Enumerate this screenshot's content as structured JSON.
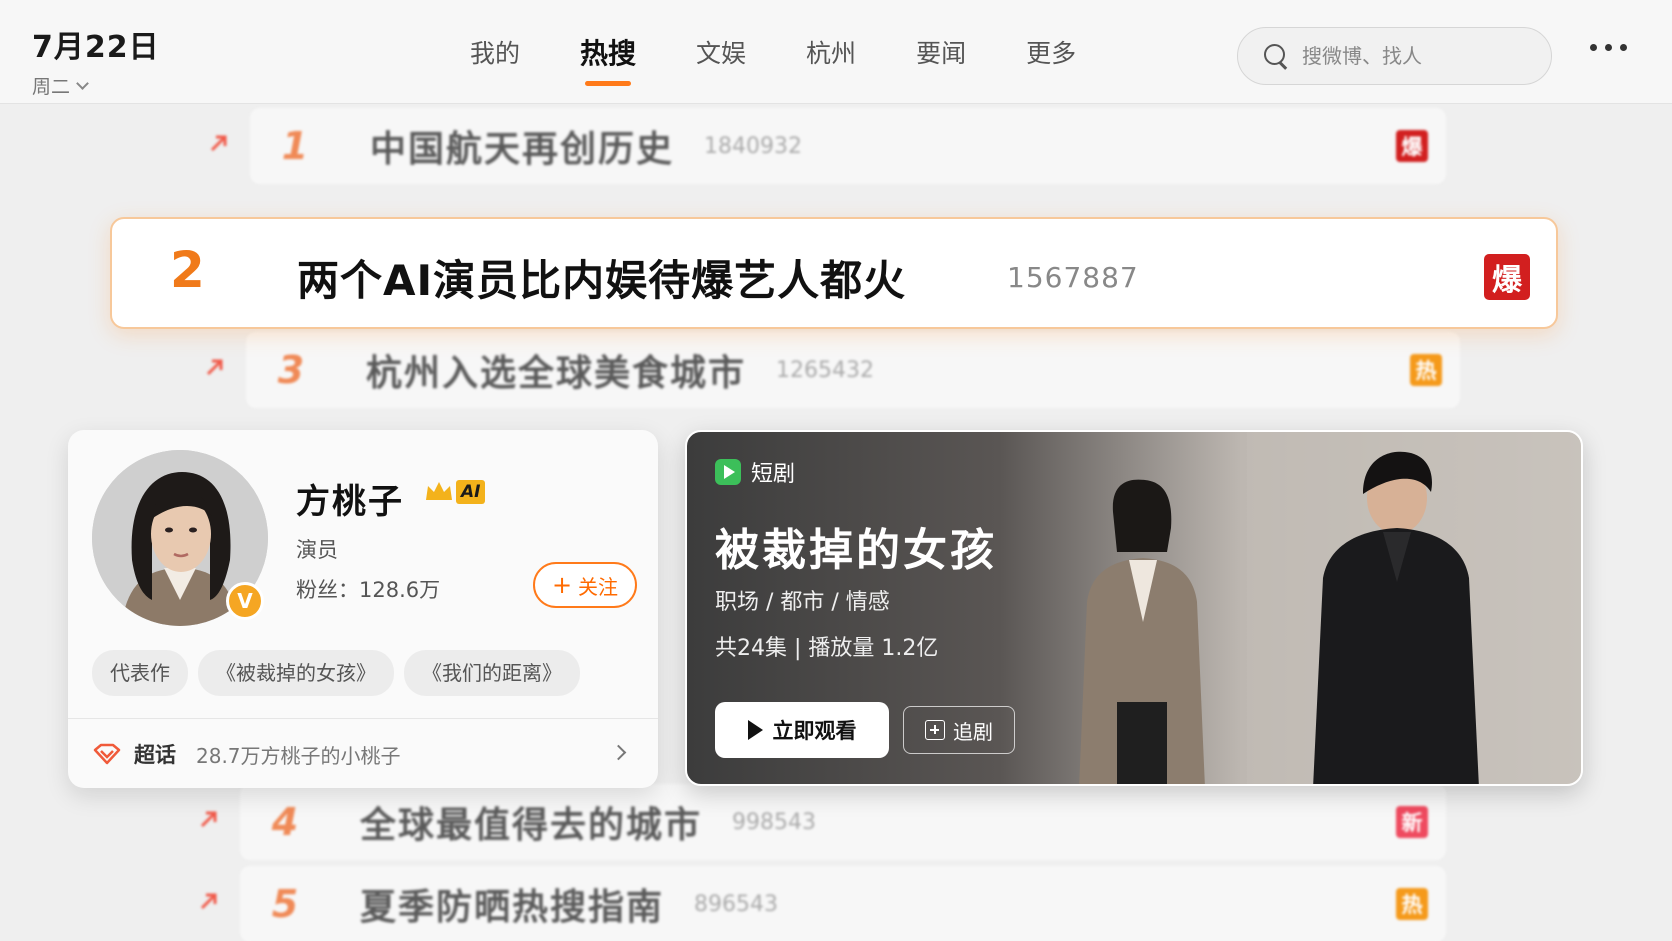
{
  "header": {
    "date": "7月22日",
    "weekday": "周二",
    "tabs": [
      {
        "label": "我的",
        "active": false
      },
      {
        "label": "热搜",
        "active": true
      },
      {
        "label": "文娱",
        "active": false
      },
      {
        "label": "杭州",
        "active": false
      },
      {
        "label": "要闻",
        "active": false
      },
      {
        "label": "更多",
        "active": false
      }
    ],
    "search_placeholder": "搜微博、找人"
  },
  "hot_list": [
    {
      "rank": "1",
      "title": "中国航天再创历史",
      "heat": "1840932",
      "badge": "爆",
      "badge_type": "bao"
    },
    {
      "rank": "3",
      "title": "杭州入选全球美食城市",
      "heat": "1265432",
      "badge": "热",
      "badge_type": "re"
    },
    {
      "rank": "4",
      "title": "全球最值得去的城市",
      "heat": "998543",
      "badge": "新",
      "badge_type": "xin"
    },
    {
      "rank": "5",
      "title": "夏季防晒热搜指南",
      "heat": "896543",
      "badge": "热",
      "badge_type": "re"
    }
  ],
  "focused": {
    "rank": "2",
    "title": "两个AI演员比内娱待爆艺人都火",
    "heat": "1567887",
    "badge": "爆"
  },
  "profile": {
    "name": "方桃子",
    "ai_label": "AI",
    "verified_mark": "V",
    "role": "演员",
    "fans": "粉丝：128.6万",
    "follow_label": "关注",
    "works_label": "代表作",
    "works": [
      "《被裁掉的女孩》",
      "《我们的距离》"
    ],
    "super_topic_label": "超话",
    "super_topic_info": "28.7万方桃子的小桃子"
  },
  "drama": {
    "tag": "短剧",
    "title": "被裁掉的女孩",
    "genres": "职场 /  都市 / 情感",
    "stats": "共24集 | 播放量 1.2亿",
    "watch_label": "立即观看",
    "follow_label": "追剧"
  },
  "colors": {
    "accent": "#ff7a1a",
    "badge_bao": "#d21f1f",
    "badge_re": "#f59a1b",
    "badge_xin": "#ef4a5f"
  }
}
